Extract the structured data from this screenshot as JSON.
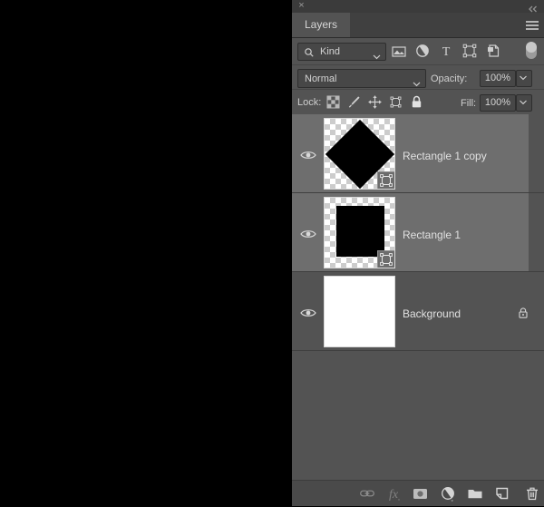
{
  "window": {
    "close_label": "×",
    "collapse_icon": "double-chevron-left-icon"
  },
  "panel": {
    "tab_label": "Layers",
    "menu_icon": "hamburger-menu-icon"
  },
  "filter_bar": {
    "kind_label": "Kind",
    "search_icon": "magnifier-icon",
    "chevron_icon": "chevron-down-icon",
    "type_filters": [
      {
        "name": "filter-pixel-layers",
        "icon": "image-icon"
      },
      {
        "name": "filter-adjustment-layers",
        "icon": "adjustment-circle-icon"
      },
      {
        "name": "filter-type-layers",
        "icon": "text-t-icon"
      },
      {
        "name": "filter-shape-layers",
        "icon": "shape-bounding-box-icon"
      },
      {
        "name": "filter-smart-objects",
        "icon": "smart-object-icon"
      }
    ],
    "toggle_name": "filter-enable-toggle"
  },
  "blend_bar": {
    "blend_mode": "Normal",
    "opacity_caption": "Opacity:",
    "opacity_value": "100%",
    "opacity_chevron": "chevron-down-icon"
  },
  "lock_bar": {
    "caption": "Lock:",
    "items": [
      {
        "name": "lock-transparent-pixels",
        "icon": "checkerboard-icon"
      },
      {
        "name": "lock-image-pixels",
        "icon": "paint-brush-icon"
      },
      {
        "name": "lock-position",
        "icon": "move-arrows-icon"
      },
      {
        "name": "lock-artboard-nesting",
        "icon": "artboard-icon"
      },
      {
        "name": "lock-all",
        "icon": "padlock-icon"
      }
    ],
    "fill_caption": "Fill:",
    "fill_value": "100%",
    "fill_chevron": "chevron-down-icon"
  },
  "layers": [
    {
      "name": "Rectangle 1 copy",
      "visible": true,
      "selected": true,
      "thumbnail": "diamond",
      "badge": "vector-shape-badge",
      "locked": false
    },
    {
      "name": "Rectangle 1",
      "visible": true,
      "selected": true,
      "thumbnail": "square",
      "badge": "vector-shape-badge",
      "locked": false
    },
    {
      "name": "Background",
      "visible": true,
      "selected": false,
      "thumbnail": "white",
      "badge": null,
      "locked": true
    }
  ],
  "footer": {
    "buttons": [
      {
        "name": "link-layers-button",
        "icon": "chain-link-icon",
        "enabled": false
      },
      {
        "name": "add-layer-style-button",
        "icon": "fx-icon",
        "enabled": false
      },
      {
        "name": "add-layer-mask-button",
        "icon": "layer-mask-icon",
        "enabled": true
      },
      {
        "name": "new-fill-adjustment-layer-button",
        "icon": "adjustment-circle-icon",
        "enabled": true
      },
      {
        "name": "new-group-button",
        "icon": "folder-icon",
        "enabled": true
      },
      {
        "name": "new-layer-button",
        "icon": "new-page-icon",
        "enabled": true
      },
      {
        "name": "delete-layer-button",
        "icon": "trash-icon",
        "enabled": true
      }
    ]
  },
  "colors": {
    "panel_bg": "#535353",
    "row_selected": "#6e6e6e",
    "titlebar": "#3b3b3b",
    "text": "#e0e0e0",
    "canvas": "#000000"
  }
}
